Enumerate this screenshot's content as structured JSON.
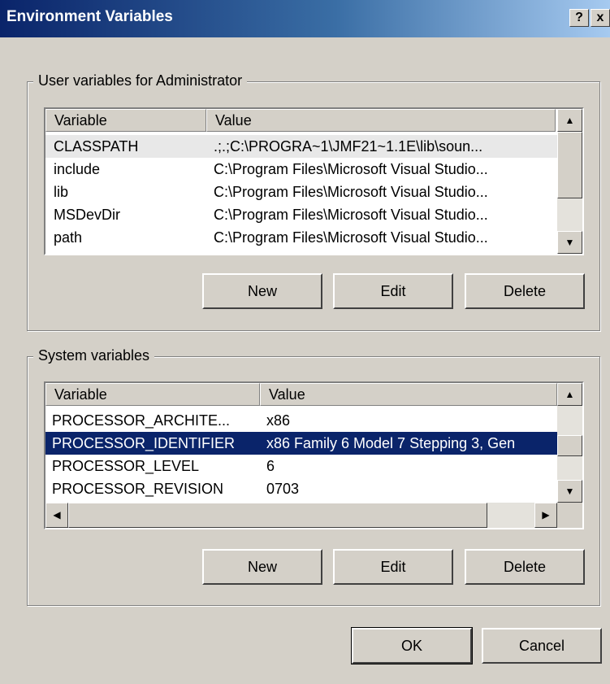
{
  "window": {
    "title": "Environment Variables",
    "help_label": "?",
    "close_label": "x"
  },
  "user_group": {
    "label": "User variables for Administrator",
    "headers": {
      "variable": "Variable",
      "value": "Value"
    },
    "rows": [
      {
        "variable": "CLASSPATH",
        "value": ".;.;C:\\PROGRA~1\\JMF21~1.1E\\lib\\soun..."
      },
      {
        "variable": "include",
        "value": "C:\\Program Files\\Microsoft Visual Studio..."
      },
      {
        "variable": "lib",
        "value": "C:\\Program Files\\Microsoft Visual Studio..."
      },
      {
        "variable": "MSDevDir",
        "value": "C:\\Program Files\\Microsoft Visual Studio..."
      },
      {
        "variable": "path",
        "value": "C:\\Program Files\\Microsoft Visual Studio..."
      }
    ],
    "buttons": {
      "new": "New",
      "edit": "Edit",
      "delete": "Delete"
    }
  },
  "system_group": {
    "label": "System variables",
    "headers": {
      "variable": "Variable",
      "value": "Value"
    },
    "rows": [
      {
        "variable": "PROCESSOR_ARCHITE...",
        "value": "x86"
      },
      {
        "variable": "PROCESSOR_IDENTIFIER",
        "value": "x86 Family 6 Model 7 Stepping 3, Gen"
      },
      {
        "variable": "PROCESSOR_LEVEL",
        "value": "6"
      },
      {
        "variable": "PROCESSOR_REVISION",
        "value": "0703"
      }
    ],
    "buttons": {
      "new": "New",
      "edit": "Edit",
      "delete": "Delete"
    }
  },
  "footer": {
    "ok": "OK",
    "cancel": "Cancel"
  },
  "icons": {
    "scroll_up": "▲",
    "scroll_down": "▼",
    "scroll_left": "◀",
    "scroll_right": "▶"
  },
  "colors": {
    "dialog_bg": "#d4d0c8",
    "selection": "#0a246a",
    "title_start": "#0a246a"
  }
}
